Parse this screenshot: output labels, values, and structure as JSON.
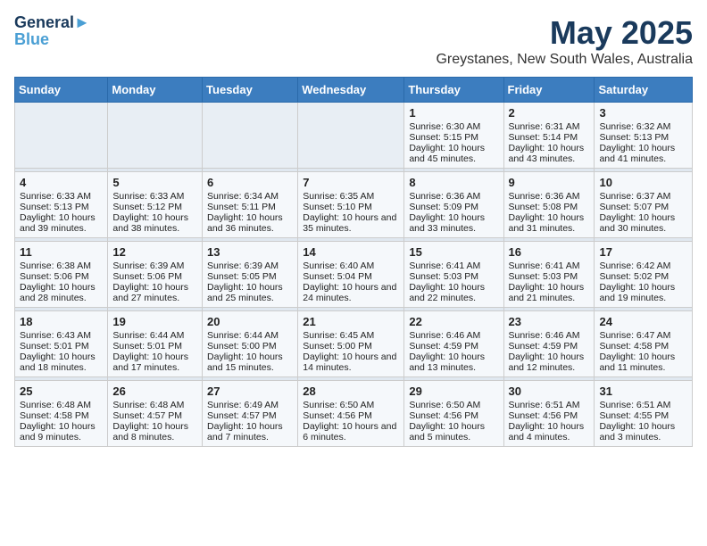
{
  "logo": {
    "line1": "General",
    "line2": "Blue"
  },
  "title": "May 2025",
  "subtitle": "Greystanes, New South Wales, Australia",
  "days_header": [
    "Sunday",
    "Monday",
    "Tuesday",
    "Wednesday",
    "Thursday",
    "Friday",
    "Saturday"
  ],
  "weeks": [
    [
      {
        "num": "",
        "empty": true
      },
      {
        "num": "",
        "empty": true
      },
      {
        "num": "",
        "empty": true
      },
      {
        "num": "",
        "empty": true
      },
      {
        "num": "1",
        "sunrise": "Sunrise: 6:30 AM",
        "sunset": "Sunset: 5:15 PM",
        "daylight": "Daylight: 10 hours and 45 minutes."
      },
      {
        "num": "2",
        "sunrise": "Sunrise: 6:31 AM",
        "sunset": "Sunset: 5:14 PM",
        "daylight": "Daylight: 10 hours and 43 minutes."
      },
      {
        "num": "3",
        "sunrise": "Sunrise: 6:32 AM",
        "sunset": "Sunset: 5:13 PM",
        "daylight": "Daylight: 10 hours and 41 minutes."
      }
    ],
    [
      {
        "num": "4",
        "sunrise": "Sunrise: 6:33 AM",
        "sunset": "Sunset: 5:13 PM",
        "daylight": "Daylight: 10 hours and 39 minutes."
      },
      {
        "num": "5",
        "sunrise": "Sunrise: 6:33 AM",
        "sunset": "Sunset: 5:12 PM",
        "daylight": "Daylight: 10 hours and 38 minutes."
      },
      {
        "num": "6",
        "sunrise": "Sunrise: 6:34 AM",
        "sunset": "Sunset: 5:11 PM",
        "daylight": "Daylight: 10 hours and 36 minutes."
      },
      {
        "num": "7",
        "sunrise": "Sunrise: 6:35 AM",
        "sunset": "Sunset: 5:10 PM",
        "daylight": "Daylight: 10 hours and 35 minutes."
      },
      {
        "num": "8",
        "sunrise": "Sunrise: 6:36 AM",
        "sunset": "Sunset: 5:09 PM",
        "daylight": "Daylight: 10 hours and 33 minutes."
      },
      {
        "num": "9",
        "sunrise": "Sunrise: 6:36 AM",
        "sunset": "Sunset: 5:08 PM",
        "daylight": "Daylight: 10 hours and 31 minutes."
      },
      {
        "num": "10",
        "sunrise": "Sunrise: 6:37 AM",
        "sunset": "Sunset: 5:07 PM",
        "daylight": "Daylight: 10 hours and 30 minutes."
      }
    ],
    [
      {
        "num": "11",
        "sunrise": "Sunrise: 6:38 AM",
        "sunset": "Sunset: 5:06 PM",
        "daylight": "Daylight: 10 hours and 28 minutes."
      },
      {
        "num": "12",
        "sunrise": "Sunrise: 6:39 AM",
        "sunset": "Sunset: 5:06 PM",
        "daylight": "Daylight: 10 hours and 27 minutes."
      },
      {
        "num": "13",
        "sunrise": "Sunrise: 6:39 AM",
        "sunset": "Sunset: 5:05 PM",
        "daylight": "Daylight: 10 hours and 25 minutes."
      },
      {
        "num": "14",
        "sunrise": "Sunrise: 6:40 AM",
        "sunset": "Sunset: 5:04 PM",
        "daylight": "Daylight: 10 hours and 24 minutes."
      },
      {
        "num": "15",
        "sunrise": "Sunrise: 6:41 AM",
        "sunset": "Sunset: 5:03 PM",
        "daylight": "Daylight: 10 hours and 22 minutes."
      },
      {
        "num": "16",
        "sunrise": "Sunrise: 6:41 AM",
        "sunset": "Sunset: 5:03 PM",
        "daylight": "Daylight: 10 hours and 21 minutes."
      },
      {
        "num": "17",
        "sunrise": "Sunrise: 6:42 AM",
        "sunset": "Sunset: 5:02 PM",
        "daylight": "Daylight: 10 hours and 19 minutes."
      }
    ],
    [
      {
        "num": "18",
        "sunrise": "Sunrise: 6:43 AM",
        "sunset": "Sunset: 5:01 PM",
        "daylight": "Daylight: 10 hours and 18 minutes."
      },
      {
        "num": "19",
        "sunrise": "Sunrise: 6:44 AM",
        "sunset": "Sunset: 5:01 PM",
        "daylight": "Daylight: 10 hours and 17 minutes."
      },
      {
        "num": "20",
        "sunrise": "Sunrise: 6:44 AM",
        "sunset": "Sunset: 5:00 PM",
        "daylight": "Daylight: 10 hours and 15 minutes."
      },
      {
        "num": "21",
        "sunrise": "Sunrise: 6:45 AM",
        "sunset": "Sunset: 5:00 PM",
        "daylight": "Daylight: 10 hours and 14 minutes."
      },
      {
        "num": "22",
        "sunrise": "Sunrise: 6:46 AM",
        "sunset": "Sunset: 4:59 PM",
        "daylight": "Daylight: 10 hours and 13 minutes."
      },
      {
        "num": "23",
        "sunrise": "Sunrise: 6:46 AM",
        "sunset": "Sunset: 4:59 PM",
        "daylight": "Daylight: 10 hours and 12 minutes."
      },
      {
        "num": "24",
        "sunrise": "Sunrise: 6:47 AM",
        "sunset": "Sunset: 4:58 PM",
        "daylight": "Daylight: 10 hours and 11 minutes."
      }
    ],
    [
      {
        "num": "25",
        "sunrise": "Sunrise: 6:48 AM",
        "sunset": "Sunset: 4:58 PM",
        "daylight": "Daylight: 10 hours and 9 minutes."
      },
      {
        "num": "26",
        "sunrise": "Sunrise: 6:48 AM",
        "sunset": "Sunset: 4:57 PM",
        "daylight": "Daylight: 10 hours and 8 minutes."
      },
      {
        "num": "27",
        "sunrise": "Sunrise: 6:49 AM",
        "sunset": "Sunset: 4:57 PM",
        "daylight": "Daylight: 10 hours and 7 minutes."
      },
      {
        "num": "28",
        "sunrise": "Sunrise: 6:50 AM",
        "sunset": "Sunset: 4:56 PM",
        "daylight": "Daylight: 10 hours and 6 minutes."
      },
      {
        "num": "29",
        "sunrise": "Sunrise: 6:50 AM",
        "sunset": "Sunset: 4:56 PM",
        "daylight": "Daylight: 10 hours and 5 minutes."
      },
      {
        "num": "30",
        "sunrise": "Sunrise: 6:51 AM",
        "sunset": "Sunset: 4:56 PM",
        "daylight": "Daylight: 10 hours and 4 minutes."
      },
      {
        "num": "31",
        "sunrise": "Sunrise: 6:51 AM",
        "sunset": "Sunset: 4:55 PM",
        "daylight": "Daylight: 10 hours and 3 minutes."
      }
    ]
  ]
}
